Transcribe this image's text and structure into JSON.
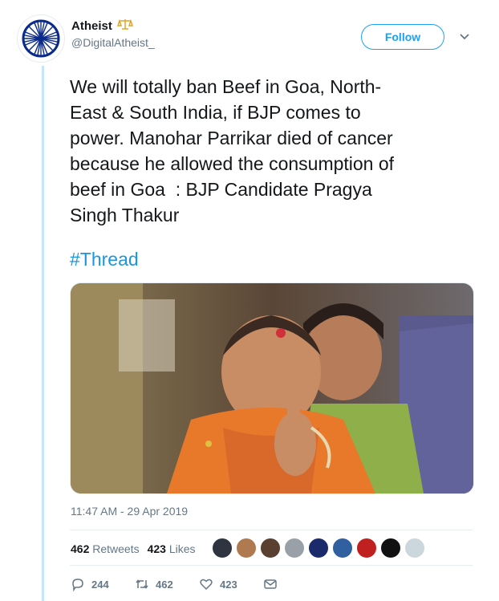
{
  "account": {
    "name": "Atheist",
    "badge_icon": "scales-icon",
    "handle": "@DigitalAtheist_",
    "follow_label": "Follow"
  },
  "tweet": {
    "text": "We will totally ban Beef in Goa, North-\nEast & South India, if BJP comes to\npower. Manohar Parrikar died of cancer\nbecause he allowed the consumption of\nbeef in Goa  : BJP Candidate Pragya\nSingh Thakur",
    "hashtag": "#Thread",
    "timestamp": "11:47 AM - 29 Apr 2019"
  },
  "stats": {
    "retweets_count": "462",
    "retweets_label": "Retweets",
    "likes_count": "423",
    "likes_label": "Likes"
  },
  "actions": {
    "reply_count": "244",
    "retweet_count": "462",
    "like_count": "423"
  },
  "colors": {
    "accent": "#1da1f2",
    "link": "#1b95e0",
    "secondary_text": "#657786",
    "thread_line": "#c4e5fa"
  }
}
